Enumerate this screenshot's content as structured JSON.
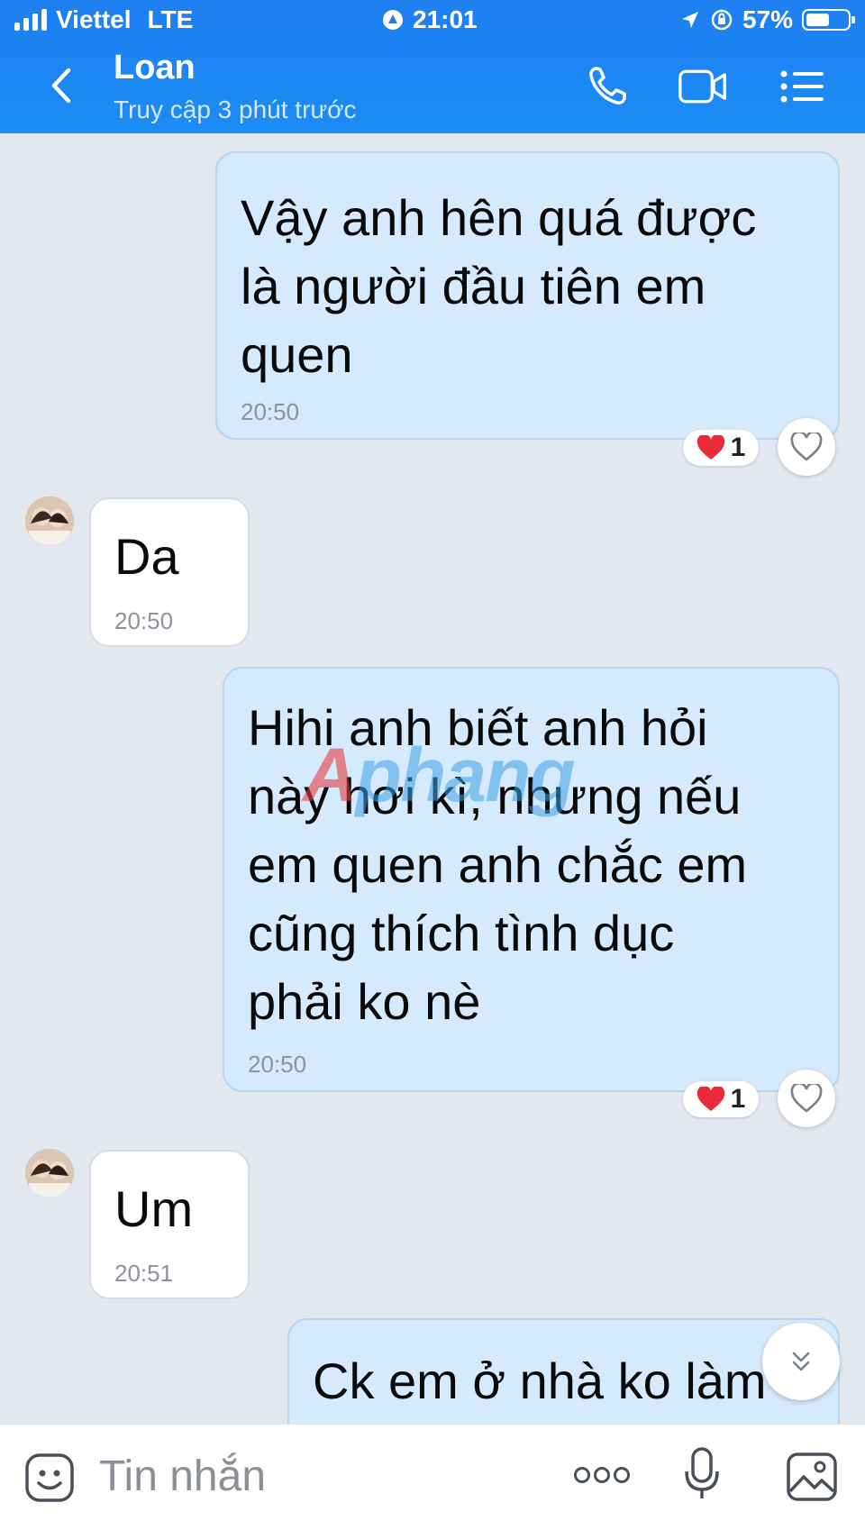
{
  "status_bar": {
    "carrier": "Viettel",
    "network": "LTE",
    "time": "21:01",
    "battery": "57%",
    "battery_level": 0.57
  },
  "header": {
    "contact_name": "Loan",
    "presence": "Truy cập 3 phút trước",
    "icons": [
      "back-chevron-icon",
      "phone-icon",
      "video-call-icon",
      "menu-list-icon"
    ]
  },
  "messages": [
    {
      "sender": "me",
      "lines": [
        "Vậy anh hên quá được",
        "là người đầu tiên em",
        "quen"
      ],
      "time": "20:50",
      "reaction_count": "1"
    },
    {
      "sender": "them",
      "lines": [
        "Da"
      ],
      "time": "20:50"
    },
    {
      "sender": "me",
      "lines": [
        "Hihi anh biết anh hỏi",
        "này hơi kì, nhưng nếu",
        "em quen anh chắc em",
        "cũng thích tình dục",
        "phải ko nè"
      ],
      "time": "20:50",
      "reaction_count": "1"
    },
    {
      "sender": "them",
      "lines": [
        "Um"
      ],
      "time": "20:51"
    },
    {
      "sender": "me",
      "lines": [
        "Ck em ở nhà ko làm"
      ]
    }
  ],
  "watermark": "Aphang",
  "composer": {
    "placeholder": "Tin nhắn",
    "icons": [
      "sticker-icon",
      "more-dots-icon",
      "microphone-icon",
      "image-icon"
    ]
  },
  "colors": {
    "header_blue": "#1f7ff2",
    "my_bubble": "#d5eafc",
    "their_bubble": "#ffffff",
    "background": "#e3e7ee"
  }
}
